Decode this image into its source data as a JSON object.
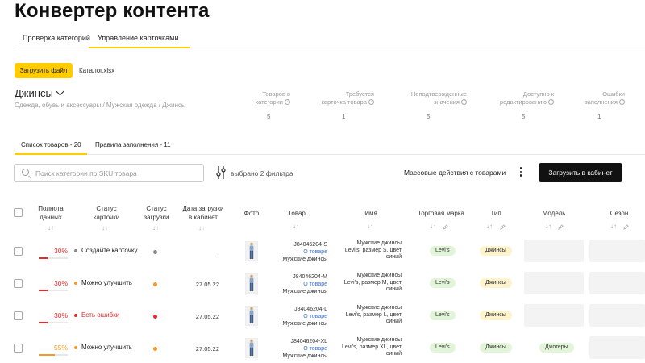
{
  "title": "Конвертер контента",
  "tabs": [
    "Проверка категорий",
    "Управление карточками"
  ],
  "upload_button": "Загрузить файл",
  "file_name": "Каталог.xlsx",
  "category": {
    "name": "Джинсы",
    "breadcrumb": "Одежда, обувь и аксессуары / Мужская одежда / Джинсы"
  },
  "stats": [
    {
      "label1": "Товаров в",
      "label2": "категории",
      "value": "5"
    },
    {
      "label1": "Требуется",
      "label2": "карточка товара",
      "value": "1"
    },
    {
      "label1": "Неподтвержденные",
      "label2": "значения",
      "value": "5"
    },
    {
      "label1": "Доступно к",
      "label2": "редактированию",
      "value": "5"
    },
    {
      "label1": "Ошибки",
      "label2": "заполнения",
      "value": "1"
    }
  ],
  "subtabs": [
    "Список товаров - 20",
    "Правила заполнения - 11"
  ],
  "search_placeholder": "Поиск категории по SKU товара",
  "filter_text": "выбрано 2 фильтра",
  "mass_actions": "Массовые действия с товарами",
  "cabinet_button": "Загрузить в кабинет",
  "columns": {
    "completeness": [
      "Полнота",
      "данных"
    ],
    "card_status": [
      "Статус",
      "карточки"
    ],
    "upload_status": [
      "Статус",
      "загрузки"
    ],
    "upload_date": [
      "Дата загрузки",
      "в кабинет"
    ],
    "photo": "Фото",
    "product": "Товар",
    "name": "Имя",
    "brand": "Торговая марка",
    "type": "Тип",
    "model": "Модель",
    "season": "Сезон"
  },
  "colors": {
    "accent": "#ffcc00",
    "red": "#e52b2b",
    "orange": "#f59a23",
    "gray": "#888888"
  },
  "rows": [
    {
      "pct": "30%",
      "pct_value": 0.3,
      "pct_color": "#e52b2b",
      "status": "Создайте карточку",
      "status_color": "#888888",
      "status_text_color": "#222222",
      "upload_color": "#888888",
      "date": "-",
      "sku": "J84046204-S",
      "link": "О товаре",
      "product_type": "Мужские джинсы",
      "name1": "Мужские джинсы",
      "name2": "Levi's, размер S, цвет",
      "name3": "синий",
      "brand": "Levi's",
      "type": "Джинсы",
      "model": ""
    },
    {
      "pct": "30%",
      "pct_value": 0.3,
      "pct_color": "#e52b2b",
      "status": "Можно улучшить",
      "status_color": "#f59a23",
      "status_text_color": "#222222",
      "upload_color": "#f59a23",
      "date": "27.05.22",
      "sku": "J84046204-M",
      "link": "О товаре",
      "product_type": "Мужские джинсы",
      "name1": "Мужские джинсы",
      "name2": "Levi's, размер M, цвет",
      "name3": "синий",
      "brand": "Levi's",
      "type": "Джинсы",
      "model": ""
    },
    {
      "pct": "30%",
      "pct_value": 0.3,
      "pct_color": "#e52b2b",
      "status": "Есть ошибки",
      "status_color": "#e52b2b",
      "status_text_color": "#e52b2b",
      "upload_color": "#e52b2b",
      "date": "27.05.22",
      "sku": "J84046204-L",
      "link": "О товаре",
      "product_type": "Мужские джинсы",
      "name1": "Мужские джинсы",
      "name2": "Levi's, размер L, цвет",
      "name3": "синий",
      "brand": "Levi's",
      "type": "Джинсы",
      "model": ""
    },
    {
      "pct": "55%",
      "pct_value": 0.55,
      "pct_color": "#f59a23",
      "status": "Можно улучшить",
      "status_color": "#f59a23",
      "status_text_color": "#222222",
      "upload_color": "#f59a23",
      "date": "27.05.22",
      "sku": "J84046204-XL",
      "link": "О товаре",
      "product_type": "Мужские джинсы",
      "name1": "Мужские джинсы",
      "name2": "Levi's, размер XL, цвет",
      "name3": "синий",
      "brand": "Levi's",
      "type": "Джинсы",
      "model": "Джогеры"
    }
  ]
}
